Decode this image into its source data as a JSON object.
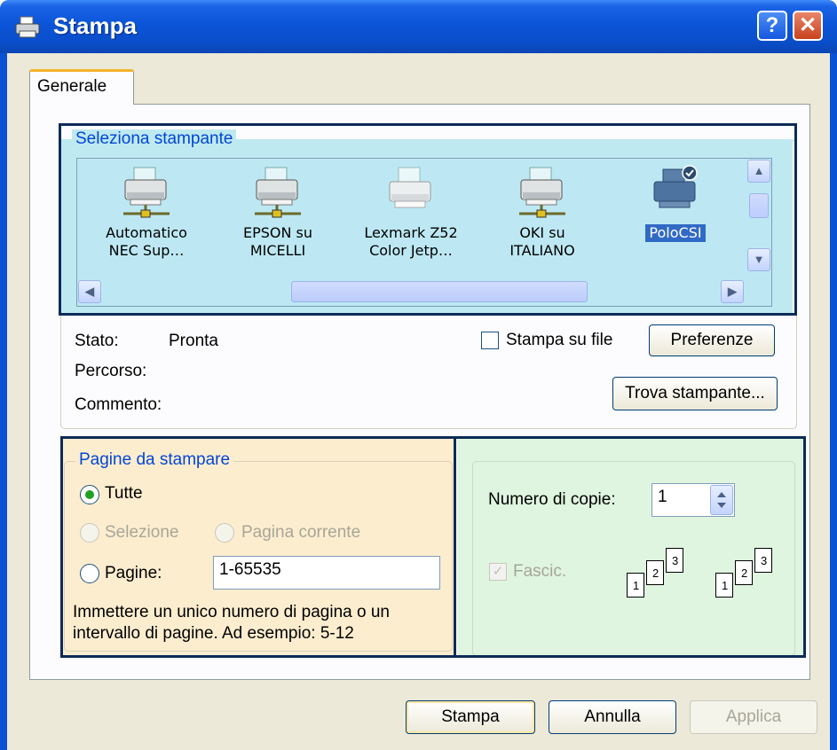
{
  "window": {
    "title": "Stampa",
    "help_glyph": "?",
    "close_glyph": "✕"
  },
  "tabs": [
    {
      "label": "Generale"
    }
  ],
  "select_printer": {
    "legend": "Seleziona stampante",
    "printers": [
      {
        "line1": "Automatico",
        "line2": "NEC Sup…",
        "icon": "network-printer-icon"
      },
      {
        "line1": "EPSON su",
        "line2": "MICELLI",
        "icon": "network-printer-icon"
      },
      {
        "line1": "Lexmark Z52",
        "line2": "Color Jetp…",
        "icon": "printer-icon"
      },
      {
        "line1": "OKI su",
        "line2": "ITALIANO",
        "icon": "network-printer-icon"
      },
      {
        "line1": "PoloCSI",
        "line2": "",
        "icon": "default-printer-icon",
        "selected": true
      }
    ],
    "status_label": "Stato:",
    "status_value": "Pronta",
    "path_label": "Percorso:",
    "comment_label": "Commento:",
    "print_to_file_label": "Stampa su file",
    "preferences_label": "Preferenze",
    "find_printer_label": "Trova stampante..."
  },
  "page_range": {
    "legend": "Pagine da stampare",
    "all_label": "Tutte",
    "selection_label": "Selezione",
    "current_page_label": "Pagina corrente",
    "pages_label": "Pagine:",
    "pages_value": "1-65535",
    "hint_line1": "Immettere un unico numero di pagina o un",
    "hint_line2": "intervallo di pagine. Ad esempio: 5-12"
  },
  "copies": {
    "label": "Numero di copie:",
    "value": "1",
    "collate_label": "Fascic.",
    "sheet_numbers": [
      "1",
      "2",
      "3"
    ]
  },
  "buttons": {
    "print": "Stampa",
    "cancel": "Annulla",
    "apply": "Applica"
  },
  "colors": {
    "titlebar": "#0a4fcc",
    "dialog_bg": "#ece9d8",
    "highlight_printers": "#bfe9f1",
    "highlight_pages": "#fdedcf",
    "highlight_copies": "#dff5e0",
    "annotation_frame": "#0c2b57",
    "group_caption": "#0046d5"
  }
}
